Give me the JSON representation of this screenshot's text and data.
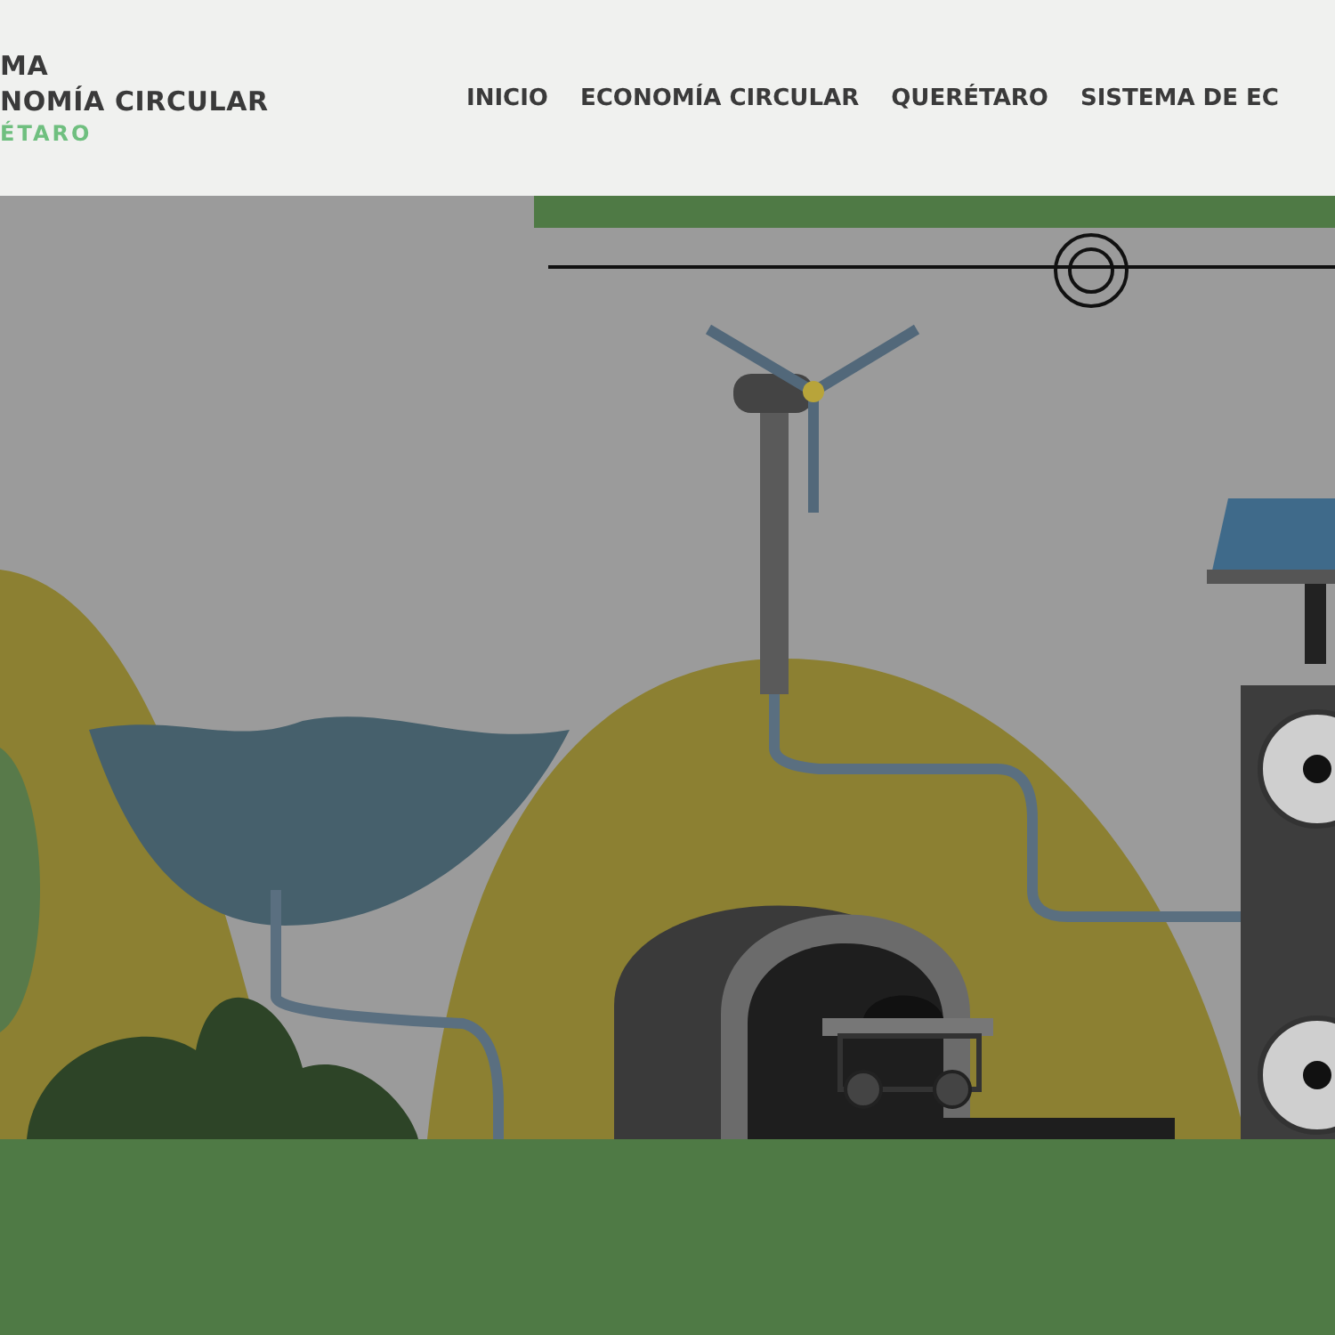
{
  "header": {
    "logo_lines": [
      "MA",
      "NOMÍA CIRCULAR",
      "ÉTARO"
    ],
    "nav": [
      {
        "label": "INICIO"
      },
      {
        "label": "ECONOMÍA CIRCULAR"
      },
      {
        "label": "QUERÉTARO"
      },
      {
        "label": "SISTEMA DE EC"
      }
    ]
  }
}
